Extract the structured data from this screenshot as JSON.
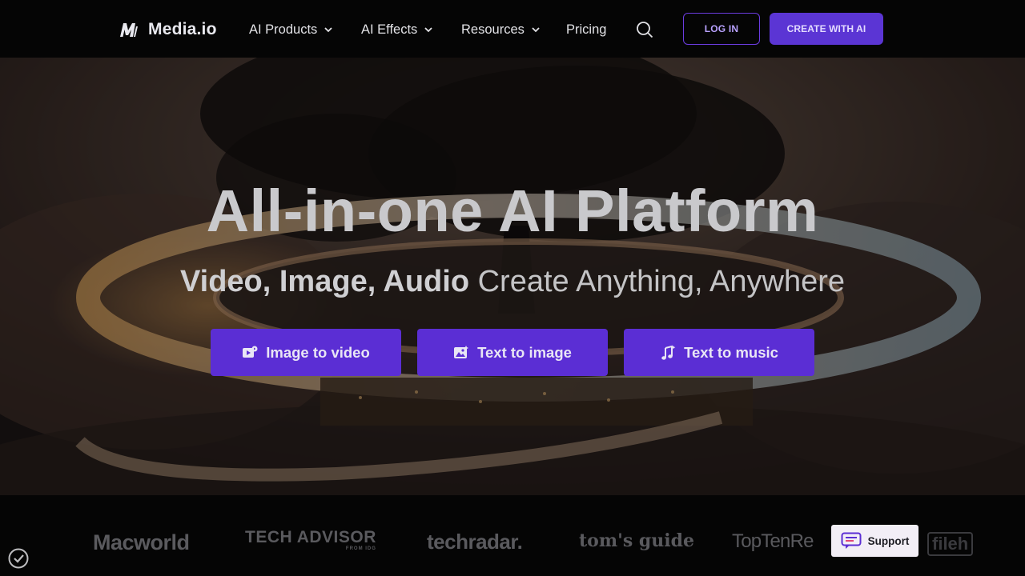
{
  "brand": {
    "name": "Media.io",
    "logo_icon": "media-io-logo-icon"
  },
  "nav": {
    "items": [
      {
        "label": "AI Products",
        "has_dropdown": true
      },
      {
        "label": "AI Effects",
        "has_dropdown": true
      },
      {
        "label": "Resources",
        "has_dropdown": true
      },
      {
        "label": "Pricing",
        "has_dropdown": false
      }
    ],
    "search_icon": "search-icon",
    "login_label": "LOG IN",
    "create_label": "CREATE WITH AI"
  },
  "hero": {
    "title": "All-in-one AI Platform",
    "subtitle_bold": "Video, Image, Audio",
    "subtitle_rest": " Create Anything, Anywhere",
    "buttons": [
      {
        "label": "Image to video",
        "icon": "image-to-video-icon"
      },
      {
        "label": "Text to image",
        "icon": "image-icon"
      },
      {
        "label": "Text to music",
        "icon": "music-note-icon"
      }
    ]
  },
  "press": {
    "logos": [
      "Macworld",
      "TECH ADVISOR",
      "FROM IDG",
      "techradar.",
      "tom's guide",
      "TopTenRe",
      "fileh"
    ]
  },
  "support": {
    "label": "Support",
    "icon": "chat-support-icon"
  },
  "colors": {
    "accent": "#5b2ed4",
    "nav_bg": "#050505",
    "login_border": "#6c3ce0"
  }
}
